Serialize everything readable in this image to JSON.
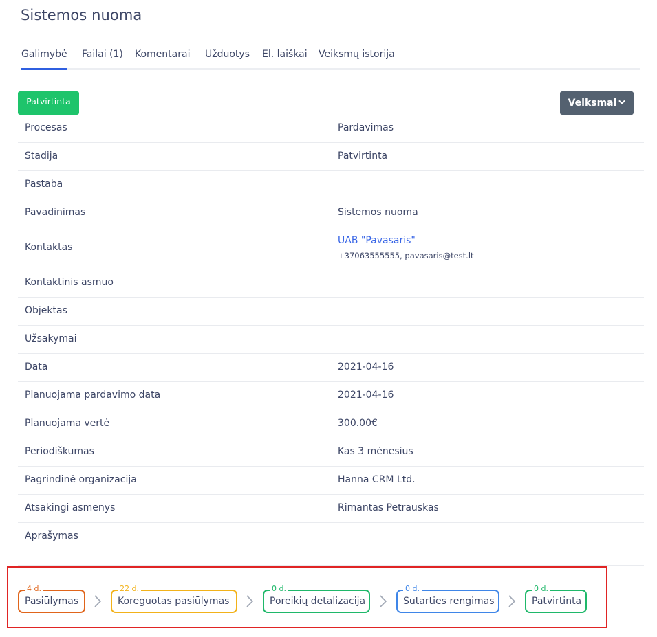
{
  "page": {
    "title": "Sistemos nuoma"
  },
  "tabs": [
    {
      "label": "Galimybė",
      "active": true
    },
    {
      "label": "Failai (1)"
    },
    {
      "label": "Komentarai"
    },
    {
      "label": "Užduotys"
    },
    {
      "label": "El. laiškai"
    },
    {
      "label": "Veiksmų istorija"
    }
  ],
  "status_button": {
    "label": "Patvirtinta",
    "color": "#1ec46b"
  },
  "actions_button": {
    "label": "Veiksmai",
    "icon": "chevron-down-icon",
    "color": "#546170"
  },
  "fields": [
    {
      "label": "Procesas",
      "value": "Pardavimas"
    },
    {
      "label": "Stadija",
      "value": "Patvirtinta"
    },
    {
      "label": "Pastaba",
      "value": ""
    },
    {
      "label": "Pavadinimas",
      "value": "Sistemos nuoma"
    },
    {
      "label": "Kontaktas",
      "value": "UAB \"Pavasaris\"",
      "sub": "+37063555555, pavasaris@test.lt"
    },
    {
      "label": "Kontaktinis asmuo",
      "value": ""
    },
    {
      "label": "Objektas",
      "value": ""
    },
    {
      "label": "Užsakymai",
      "value": ""
    },
    {
      "label": "Data",
      "value": "2021-04-16"
    },
    {
      "label": "Planuojama pardavimo data",
      "value": "2021-04-16"
    },
    {
      "label": "Planuojama vertė",
      "value": "300.00€"
    },
    {
      "label": "Periodiškumas",
      "value": "Kas 3 mėnesius"
    },
    {
      "label": "Pagrindinė organizacija",
      "value": "Hanna CRM Ltd."
    },
    {
      "label": "Atsakingi asmenys",
      "value": "Rimantas Petrauskas"
    },
    {
      "label": "Aprašymas",
      "value": ""
    }
  ],
  "pipeline": [
    {
      "label": "Pasiūlymas",
      "days": "4 d.",
      "color": "#e0651b"
    },
    {
      "label": "Koreguotas pasiūlymas",
      "days": "22 d.",
      "color": "#f2b21a"
    },
    {
      "label": "Poreikių detalizacija",
      "days": "0 d.",
      "color": "#1fb86a"
    },
    {
      "label": "Sutarties rengimas",
      "days": "0 d.",
      "color": "#3f86e8"
    },
    {
      "label": "Patvirtinta",
      "days": "0 d.",
      "color": "#1fb86a"
    }
  ],
  "highlight_color": "#e02424"
}
